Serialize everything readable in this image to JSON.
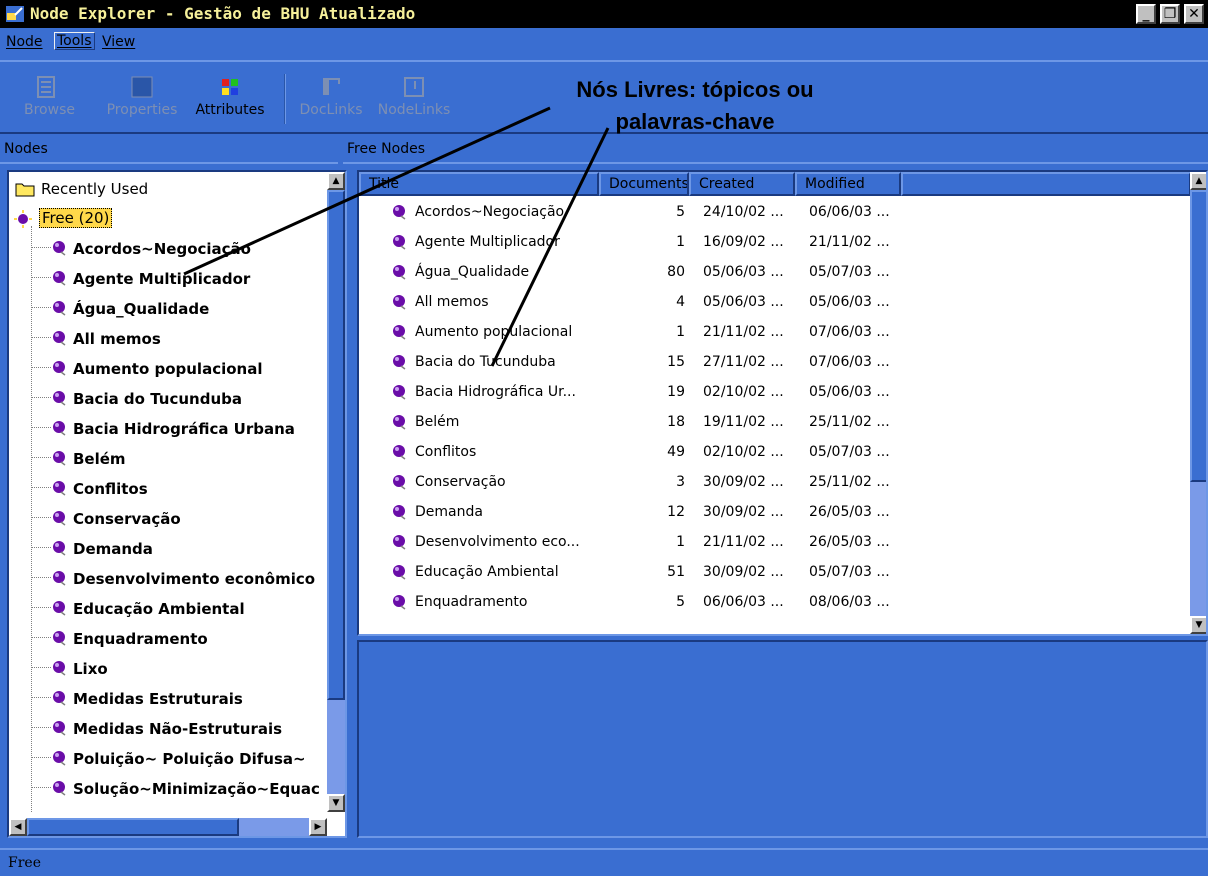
{
  "window": {
    "title": "Node Explorer - Gestão de BHU Atualizado",
    "minimize_glyph": "_",
    "restore_glyph": "❐",
    "close_glyph": "✕"
  },
  "menu": {
    "items": [
      {
        "label": "Node"
      },
      {
        "label": "Tools"
      },
      {
        "label": "View"
      }
    ]
  },
  "toolbar": {
    "buttons": [
      {
        "label": "Browse",
        "icon": "browse-icon",
        "enabled": false
      },
      {
        "label": "Properties",
        "icon": "properties-icon",
        "enabled": false
      },
      {
        "label": "Attributes",
        "icon": "attributes-icon",
        "enabled": true
      },
      {
        "label": "DocLinks",
        "icon": "doclinks-icon",
        "enabled": false
      },
      {
        "label": "NodeLinks",
        "icon": "nodelinks-icon",
        "enabled": false
      }
    ]
  },
  "panes": {
    "left_header": "Nodes",
    "right_header": "Free Nodes"
  },
  "tree": {
    "recently_used": "Recently Used",
    "free": "Free (20)",
    "children": [
      "Acordos~Negociação",
      "Agente Multiplicador",
      "Água_Qualidade",
      "All memos",
      "Aumento populacional",
      "Bacia do Tucunduba",
      "Bacia Hidrográfica Urbana",
      "Belém",
      "Conflitos",
      "Conservação",
      "Demanda",
      "Desenvolvimento econômico",
      "Educação Ambiental",
      "Enquadramento",
      "Lixo",
      "Medidas Estruturais",
      "Medidas Não-Estruturais",
      "Poluição~ Poluição Difusa~",
      "Solução~Minimização~Equac"
    ]
  },
  "list": {
    "columns": [
      "Title",
      "Documents",
      "Created",
      "Modified"
    ],
    "rows": [
      {
        "title": "Acordos~Negociação",
        "documents": "5",
        "created": "24/10/02 ...",
        "modified": "06/06/03 ..."
      },
      {
        "title": "Agente Multiplicador",
        "documents": "1",
        "created": "16/09/02 ...",
        "modified": "21/11/02 ..."
      },
      {
        "title": "Água_Qualidade",
        "documents": "80",
        "created": "05/06/03 ...",
        "modified": "05/07/03 ..."
      },
      {
        "title": "All memos",
        "documents": "4",
        "created": "05/06/03 ...",
        "modified": "05/06/03 ..."
      },
      {
        "title": "Aumento populacional",
        "documents": "1",
        "created": "21/11/02 ...",
        "modified": "07/06/03 ..."
      },
      {
        "title": "Bacia do Tucunduba",
        "documents": "15",
        "created": "27/11/02 ...",
        "modified": "07/06/03 ..."
      },
      {
        "title": "Bacia Hidrográfica Ur...",
        "documents": "19",
        "created": "02/10/02 ...",
        "modified": "05/06/03 ..."
      },
      {
        "title": "Belém",
        "documents": "18",
        "created": "19/11/02 ...",
        "modified": "25/11/02 ..."
      },
      {
        "title": "Conflitos",
        "documents": "49",
        "created": "02/10/02 ...",
        "modified": "05/07/03 ..."
      },
      {
        "title": "Conservação",
        "documents": "3",
        "created": "30/09/02 ...",
        "modified": "25/11/02 ..."
      },
      {
        "title": "Demanda",
        "documents": "12",
        "created": "30/09/02 ...",
        "modified": "26/05/03 ..."
      },
      {
        "title": "Desenvolvimento eco...",
        "documents": "1",
        "created": "21/11/02 ...",
        "modified": "26/05/03 ..."
      },
      {
        "title": "Educação Ambiental",
        "documents": "51",
        "created": "30/09/02 ...",
        "modified": "05/07/03 ..."
      },
      {
        "title": "Enquadramento",
        "documents": "5",
        "created": "06/06/03 ...",
        "modified": "08/06/03 ..."
      }
    ]
  },
  "status": {
    "text": "Free"
  },
  "annotation": {
    "line1": "Nós Livres: tópicos ou",
    "line2": "palavras-chave"
  },
  "colors": {
    "window_bg": "#3a6ed1",
    "titlebar_bg": "#000000",
    "titlebar_text": "#f6f09a",
    "highlight": "#ffd84a",
    "node_icon": "#6a0da8"
  }
}
